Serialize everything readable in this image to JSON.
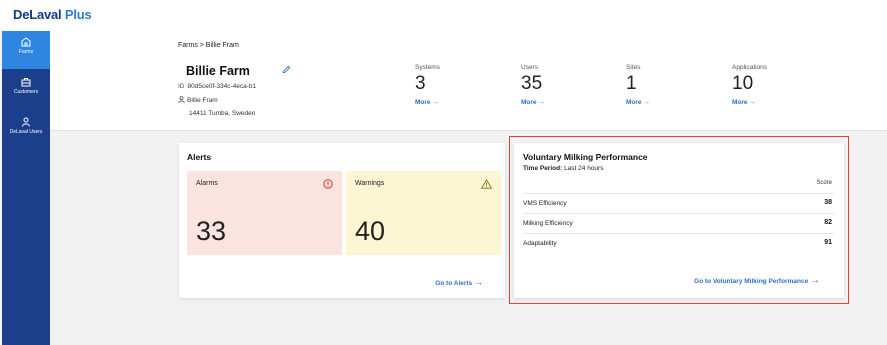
{
  "brand": {
    "name": "DeLaval",
    "suffix": " Plus"
  },
  "sidebar": {
    "items": [
      {
        "label": "Farms",
        "icon": "farm-icon",
        "active": true
      },
      {
        "label": "Customers",
        "icon": "briefcase-icon",
        "active": false
      },
      {
        "label": "DeLaval Users",
        "icon": "users-icon",
        "active": false
      }
    ]
  },
  "header": {
    "breadcrumb": "Farms > Billie Fram",
    "farm_name": "Billie Farm",
    "id_label": "ID",
    "id_value": "80d5ce0f-334c-4eca-b1",
    "contact_name": "Billie Fram",
    "address": "14411 Tumba, Sweden",
    "stats": [
      {
        "label": "Systems",
        "value": "3",
        "more": "More"
      },
      {
        "label": "Users",
        "value": "35",
        "more": "More"
      },
      {
        "label": "Sites",
        "value": "1",
        "more": "More"
      },
      {
        "label": "Applications",
        "value": "10",
        "more": "More"
      }
    ]
  },
  "alerts": {
    "title": "Alerts",
    "alarms_label": "Alarms",
    "alarms_value": "33",
    "warnings_label": "Warnings",
    "warnings_value": "40",
    "link": "Go to Alerts"
  },
  "vmp": {
    "title": "Voluntary Milking Performance",
    "period_label": "Time Period:",
    "period_value": " Last 24 hours",
    "score_header": "Score",
    "rows": [
      {
        "label": "VMS Efficiency",
        "score": "38"
      },
      {
        "label": "Milking Efficiency",
        "score": "82"
      },
      {
        "label": "Adaptability",
        "score": "91"
      }
    ],
    "link": "Go to Voluntary Milking Performance"
  },
  "colors": {
    "brand": "#103a8a",
    "sidebar": "#1c3f8b",
    "sidebar_active": "#2e86e0",
    "link": "#2e6fd1",
    "alarm_bg": "#fbe3e0",
    "warning_bg": "#fdf6d2",
    "highlight_border": "#e0442a"
  }
}
